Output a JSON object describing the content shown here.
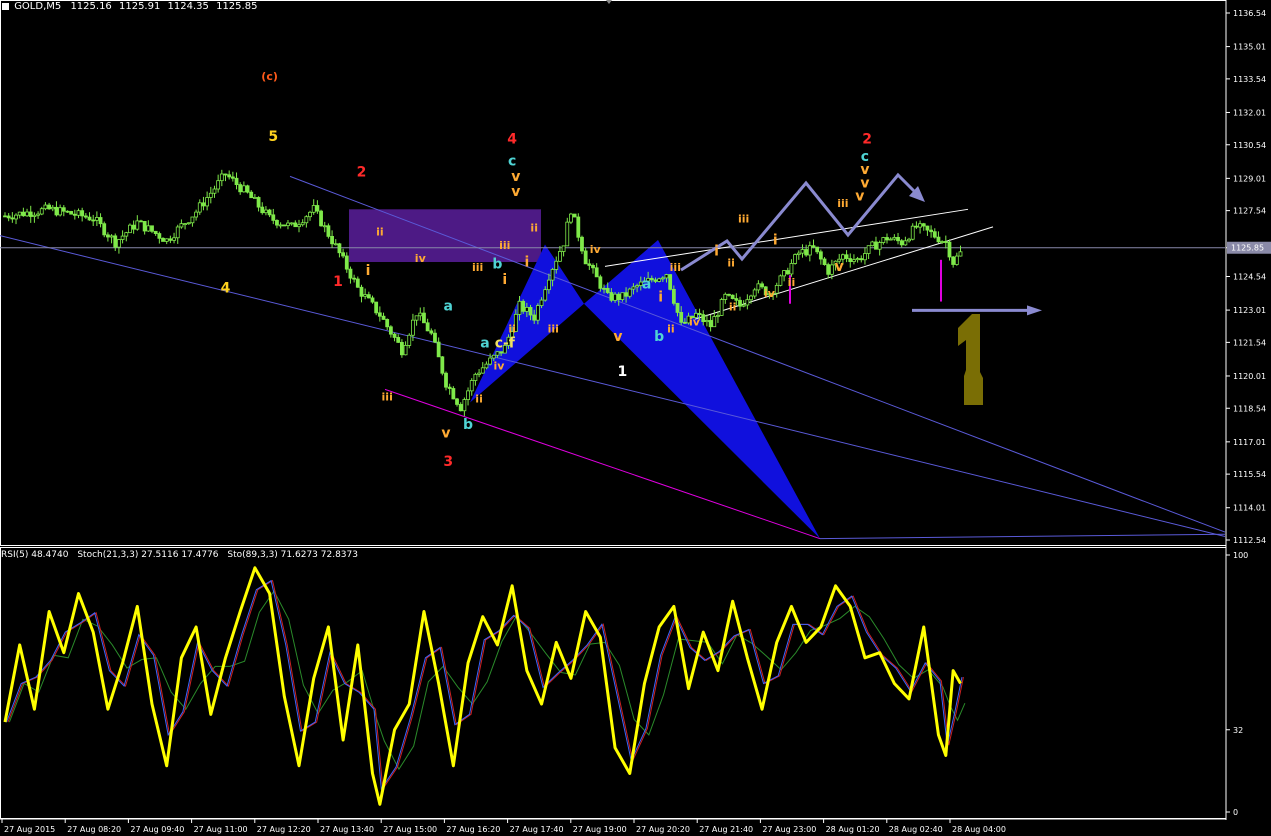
{
  "symbol_header": {
    "symbol": "GOLD,M5",
    "ohlc": [
      "1125.16",
      "1125.91",
      "1124.35",
      "1125.85"
    ]
  },
  "indicator_header": {
    "rsi": "RSI(5) 48.4740",
    "stoch_fast": "Stoch(21,3,3) 27.5116 17.4776",
    "stoch_slow": "Sto(89,3,3) 71.6273 72.8373"
  },
  "colors": {
    "background": "#000000",
    "candle": "#7fe94a",
    "trendline": "#5a5ad8",
    "zone": "#5b1f9c",
    "harmonic": "#1010dd",
    "path_arrow": "#8a8ad0",
    "rsi": "#ffff00",
    "magenta": "#e000e0",
    "olive": "#7a6e05",
    "stoch_fast": "#3a66ff",
    "stoch_slow": "#2a8a2a",
    "stoch_red": "#cc2222"
  },
  "price_axis": {
    "ticks": [
      "1136.54",
      "1135.01",
      "1133.54",
      "1132.01",
      "1130.54",
      "1129.01",
      "1127.54",
      "1125.85",
      "1124.54",
      "1123.01",
      "1121.54",
      "1120.01",
      "1118.54",
      "1117.01",
      "1115.54",
      "1114.01",
      "1112.54"
    ],
    "current_price": "1125.85"
  },
  "osc_axis": {
    "ticks": [
      "100",
      "32",
      "0"
    ]
  },
  "time_axis": {
    "labels": [
      "27 Aug 2015",
      "27 Aug 08:20",
      "27 Aug 09:40",
      "27 Aug 11:00",
      "27 Aug 12:20",
      "27 Aug 13:40",
      "27 Aug 15:00",
      "27 Aug 16:20",
      "27 Aug 17:40",
      "27 Aug 19:00",
      "27 Aug 20:20",
      "27 Aug 21:40",
      "27 Aug 23:00",
      "28 Aug 01:20",
      "28 Aug 02:40",
      "28 Aug 04:00"
    ]
  },
  "chart_data": {
    "type": "candlestick",
    "symbol": "GOLD",
    "timeframe": "M5",
    "ylim": [
      1112.54,
      1136.54
    ],
    "close_path": [
      [
        0,
        1127.3
      ],
      [
        6,
        1127.6
      ],
      [
        12,
        1127.2
      ],
      [
        15,
        1126.1
      ],
      [
        18,
        1127.0
      ],
      [
        22,
        1126.2
      ],
      [
        26,
        1127.5
      ],
      [
        30,
        1129.2
      ],
      [
        33,
        1128.3
      ],
      [
        36,
        1127.2
      ],
      [
        39,
        1126.8
      ],
      [
        42,
        1127.6
      ],
      [
        45,
        1125.9
      ],
      [
        48,
        1124.0
      ],
      [
        51,
        1122.8
      ],
      [
        54,
        1121.2
      ],
      [
        56,
        1122.9
      ],
      [
        58,
        1121.9
      ],
      [
        60,
        1119.7
      ],
      [
        62,
        1118.6
      ],
      [
        64,
        1120.1
      ],
      [
        66,
        1120.7
      ],
      [
        68,
        1121.3
      ],
      [
        70,
        1123.2
      ],
      [
        72,
        1122.7
      ],
      [
        74,
        1124.6
      ],
      [
        76,
        1126.1
      ],
      [
        77,
        1127.6
      ],
      [
        79,
        1125.3
      ],
      [
        82,
        1123.6
      ],
      [
        84,
        1123.6
      ],
      [
        86,
        1124.1
      ],
      [
        88,
        1124.4
      ],
      [
        90,
        1124.7
      ],
      [
        92,
        1122.3
      ],
      [
        94,
        1122.8
      ],
      [
        96,
        1122.3
      ],
      [
        98,
        1123.6
      ],
      [
        100,
        1123.2
      ],
      [
        102,
        1124.1
      ],
      [
        104,
        1123.8
      ],
      [
        106,
        1124.6
      ],
      [
        108,
        1125.6
      ],
      [
        110,
        1125.8
      ],
      [
        112,
        1124.8
      ],
      [
        114,
        1125.5
      ],
      [
        116,
        1125.3
      ],
      [
        118,
        1125.9
      ],
      [
        120,
        1126.3
      ],
      [
        122,
        1126.1
      ],
      [
        124,
        1126.8
      ],
      [
        126,
        1126.5
      ],
      [
        128,
        1126.1
      ],
      [
        129,
        1125.2
      ],
      [
        130,
        1125.6
      ]
    ],
    "wave_labels": [
      {
        "text": "(c)",
        "x": 36.0,
        "price": 1133.5
      },
      {
        "text": "5",
        "x": 36.5,
        "price": 1130.7
      },
      {
        "text": "4",
        "x": 30.0,
        "price": 1123.8
      },
      {
        "text": "2",
        "x": 48.5,
        "price": 1129.1
      },
      {
        "text": "1",
        "x": 45.3,
        "price": 1124.1
      },
      {
        "text": "i",
        "x": 49.4,
        "price": 1124.6
      },
      {
        "text": "ii",
        "x": 51.0,
        "price": 1126.4
      },
      {
        "text": "iv",
        "x": 56.5,
        "price": 1125.2
      },
      {
        "text": "iii",
        "x": 52.0,
        "price": 1118.9
      },
      {
        "text": "a",
        "x": 60.3,
        "price": 1123.0
      },
      {
        "text": "v",
        "x": 60.0,
        "price": 1117.2
      },
      {
        "text": "b",
        "x": 63.0,
        "price": 1117.6
      },
      {
        "text": "3",
        "x": 60.3,
        "price": 1115.9
      },
      {
        "text": "iii",
        "x": 64.3,
        "price": 1124.8
      },
      {
        "text": "b",
        "x": 67.0,
        "price": 1124.9
      },
      {
        "text": "4",
        "x": 69.0,
        "price": 1130.6
      },
      {
        "text": "c",
        "x": 69.0,
        "price": 1129.6
      },
      {
        "text": "v",
        "x": 69.5,
        "price": 1128.9
      },
      {
        "text": "v",
        "x": 69.5,
        "price": 1128.2
      },
      {
        "text": "ii",
        "x": 72.0,
        "price": 1126.6
      },
      {
        "text": "iii",
        "x": 68.0,
        "price": 1125.8
      },
      {
        "text": "i",
        "x": 71.0,
        "price": 1125.0
      },
      {
        "text": "i",
        "x": 68.0,
        "price": 1124.2
      },
      {
        "text": "ii",
        "x": 69.0,
        "price": 1122.0
      },
      {
        "text": "a",
        "x": 65.3,
        "price": 1121.3
      },
      {
        "text": "c-f",
        "x": 68.0,
        "price": 1121.3
      },
      {
        "text": "iv",
        "x": 67.2,
        "price": 1120.3
      },
      {
        "text": "ii",
        "x": 64.5,
        "price": 1118.8
      },
      {
        "text": "iii",
        "x": 74.6,
        "price": 1122.0
      },
      {
        "text": "iv",
        "x": 80.3,
        "price": 1125.6
      },
      {
        "text": "v",
        "x": 83.4,
        "price": 1121.6
      },
      {
        "text": "1",
        "x": 84.0,
        "price": 1120.0
      },
      {
        "text": "b",
        "x": 89.0,
        "price": 1121.6
      },
      {
        "text": "a",
        "x": 87.3,
        "price": 1124.0
      },
      {
        "text": "i",
        "x": 89.2,
        "price": 1123.4
      },
      {
        "text": "ii",
        "x": 90.6,
        "price": 1122.0
      },
      {
        "text": "iii",
        "x": 91.2,
        "price": 1124.8
      },
      {
        "text": "iv",
        "x": 93.8,
        "price": 1122.3
      },
      {
        "text": "i",
        "x": 96.8,
        "price": 1125.5
      },
      {
        "text": "ii",
        "x": 99.0,
        "price": 1123.0
      },
      {
        "text": "iii",
        "x": 100.5,
        "price": 1127.0
      },
      {
        "text": "ii",
        "x": 98.8,
        "price": 1125.0
      },
      {
        "text": "iv",
        "x": 104.0,
        "price": 1123.6
      },
      {
        "text": "i",
        "x": 104.8,
        "price": 1126.0
      },
      {
        "text": "ii",
        "x": 107.0,
        "price": 1124.1
      },
      {
        "text": "v",
        "x": 113.5,
        "price": 1124.8
      },
      {
        "text": "iii",
        "x": 114.0,
        "price": 1127.7
      },
      {
        "text": "v",
        "x": 116.3,
        "price": 1128.0
      },
      {
        "text": "2",
        "x": 117.3,
        "price": 1130.6
      },
      {
        "text": "c",
        "x": 117.0,
        "price": 1129.8
      },
      {
        "text": "v",
        "x": 117.0,
        "price": 1129.2
      },
      {
        "text": "v",
        "x": 117.0,
        "price": 1128.6
      }
    ],
    "oscillators": {
      "ylim": [
        0,
        100
      ],
      "series": [
        {
          "name": "RSI(5)",
          "last": 48.474
        },
        {
          "name": "Stoch(21,3,3)",
          "last": [
            27.5116,
            17.4776
          ]
        },
        {
          "name": "Sto(89,3,3)",
          "last": [
            71.6273,
            72.8373
          ]
        }
      ],
      "rsi_path": [
        [
          0,
          35
        ],
        [
          2,
          65
        ],
        [
          4,
          40
        ],
        [
          6,
          78
        ],
        [
          8,
          62
        ],
        [
          10,
          85
        ],
        [
          12,
          70
        ],
        [
          14,
          40
        ],
        [
          16,
          58
        ],
        [
          18,
          80
        ],
        [
          20,
          42
        ],
        [
          22,
          18
        ],
        [
          24,
          60
        ],
        [
          26,
          72
        ],
        [
          28,
          38
        ],
        [
          30,
          60
        ],
        [
          32,
          78
        ],
        [
          34,
          95
        ],
        [
          36,
          85
        ],
        [
          38,
          45
        ],
        [
          40,
          18
        ],
        [
          42,
          52
        ],
        [
          44,
          72
        ],
        [
          46,
          28
        ],
        [
          48,
          65
        ],
        [
          50,
          15
        ],
        [
          51,
          3
        ],
        [
          53,
          32
        ],
        [
          55,
          42
        ],
        [
          57,
          78
        ],
        [
          59,
          50
        ],
        [
          61,
          18
        ],
        [
          63,
          58
        ],
        [
          65,
          76
        ],
        [
          67,
          65
        ],
        [
          69,
          88
        ],
        [
          71,
          55
        ],
        [
          73,
          42
        ],
        [
          75,
          66
        ],
        [
          77,
          52
        ],
        [
          79,
          78
        ],
        [
          81,
          68
        ],
        [
          83,
          25
        ],
        [
          85,
          15
        ],
        [
          87,
          50
        ],
        [
          89,
          72
        ],
        [
          91,
          80
        ],
        [
          93,
          48
        ],
        [
          95,
          70
        ],
        [
          97,
          55
        ],
        [
          99,
          82
        ],
        [
          101,
          60
        ],
        [
          103,
          40
        ],
        [
          105,
          66
        ],
        [
          107,
          80
        ],
        [
          109,
          66
        ],
        [
          111,
          72
        ],
        [
          113,
          88
        ],
        [
          115,
          80
        ],
        [
          117,
          60
        ],
        [
          119,
          62
        ],
        [
          121,
          50
        ],
        [
          123,
          44
        ],
        [
          125,
          72
        ],
        [
          127,
          30
        ],
        [
          128,
          22
        ],
        [
          129,
          55
        ],
        [
          130,
          50
        ]
      ]
    },
    "current_price": 1125.85
  }
}
